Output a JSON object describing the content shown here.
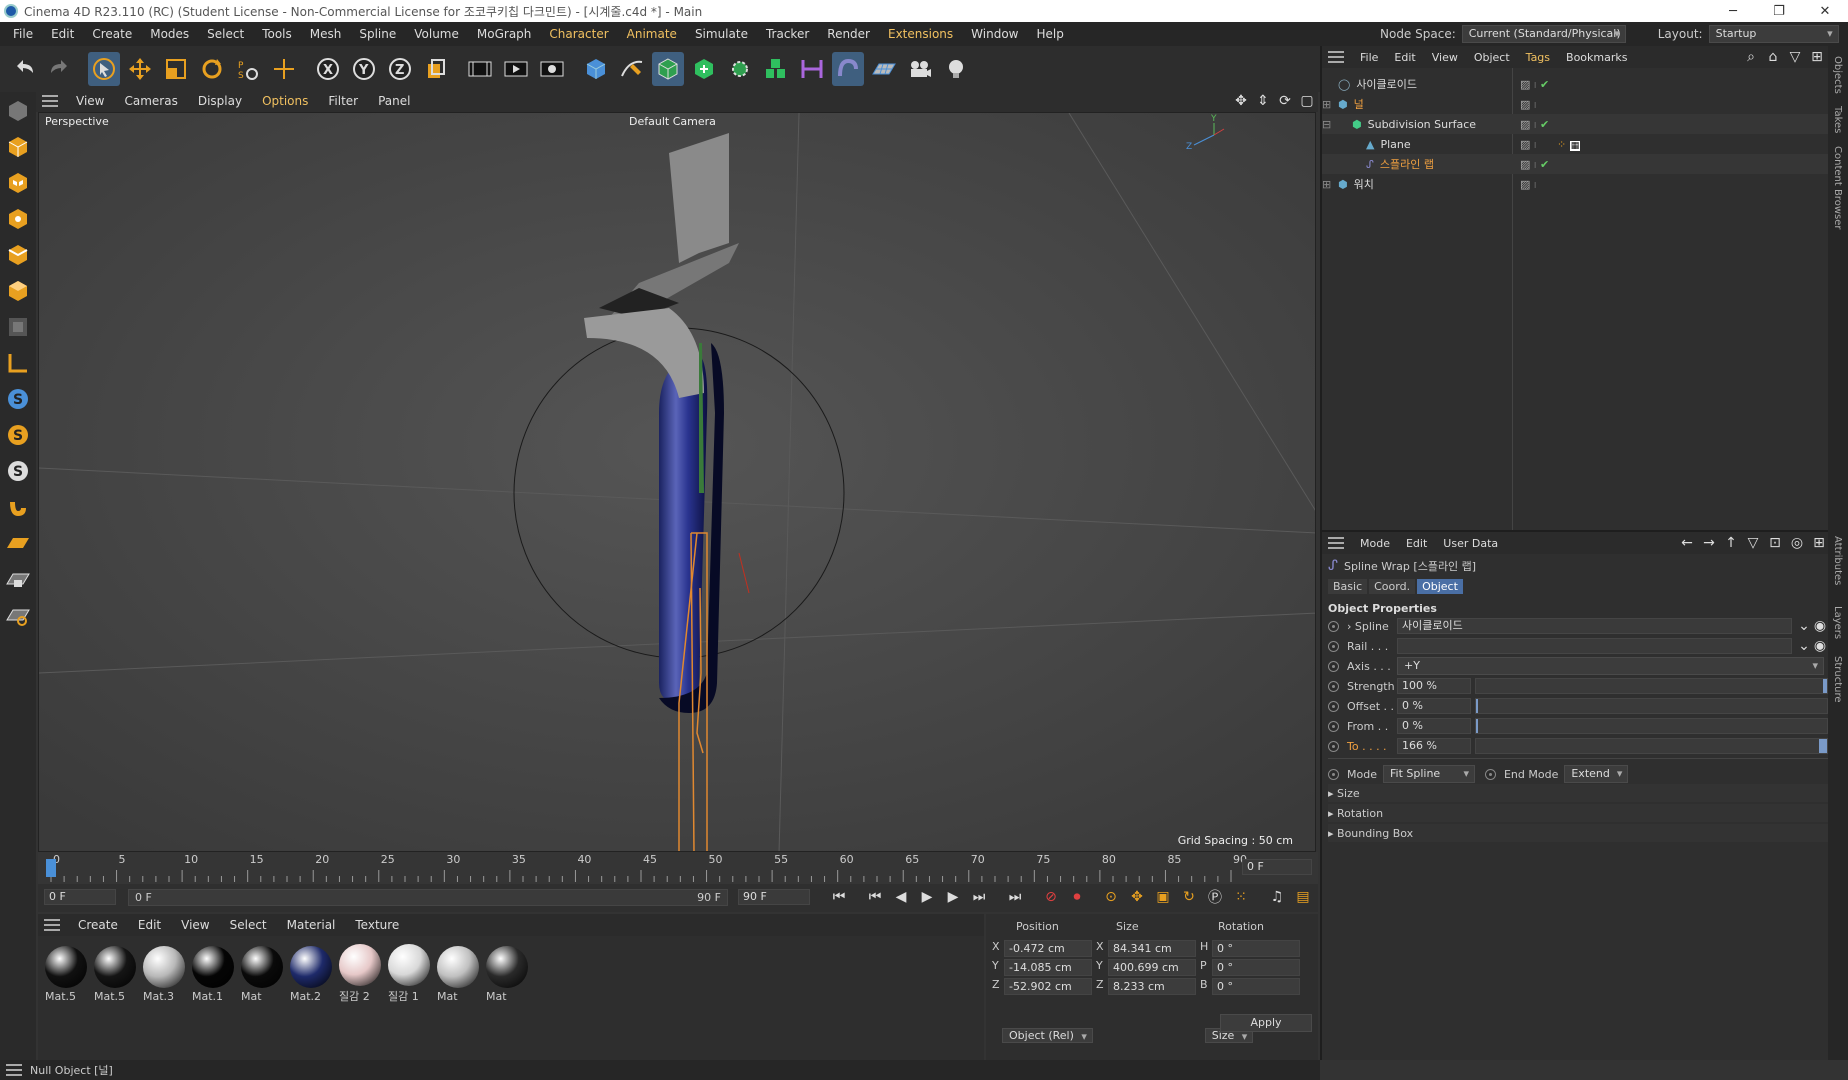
{
  "window": {
    "title": "Cinema 4D R23.110 (RC) (Student License - Non-Commercial License for 조코쿠키칩 다크민트) - [시계줄.c4d *] - Main",
    "min": "─",
    "max": "❐",
    "close": "✕"
  },
  "menu": [
    "File",
    "Edit",
    "Create",
    "Modes",
    "Select",
    "Tools",
    "Mesh",
    "Spline",
    "Volume",
    "MoGraph",
    "Character",
    "Animate",
    "Simulate",
    "Tracker",
    "Render",
    "Extensions",
    "Window",
    "Help"
  ],
  "nodespace": {
    "label": "Node Space:",
    "value": "Current (Standard/Physical)",
    "layout_label": "Layout:",
    "layout_value": "Startup"
  },
  "viewport": {
    "menu": [
      "View",
      "Cameras",
      "Display",
      "Options",
      "Filter",
      "Panel"
    ],
    "projection": "Perspective",
    "camera": "Default Camera",
    "grid_spacing": "Grid Spacing : 50 cm"
  },
  "timeline": {
    "ticks": [
      "0",
      "5",
      "10",
      "15",
      "20",
      "25",
      "30",
      "35",
      "40",
      "45",
      "50",
      "55",
      "60",
      "65",
      "70",
      "75",
      "80",
      "85",
      "90"
    ],
    "current_frame": "0 F",
    "start_frame": "0 F",
    "range_start": "0 F",
    "range_end": "90 F",
    "end_frame": "90 F"
  },
  "materials": {
    "menu": [
      "Create",
      "Edit",
      "View",
      "Select",
      "Material",
      "Texture"
    ],
    "items": [
      {
        "name": "Mat.5",
        "color": "#111"
      },
      {
        "name": "Mat.5",
        "color": "#151515"
      },
      {
        "name": "Mat.3",
        "color": "#b8b8b8"
      },
      {
        "name": "Mat.1",
        "color": "#050505"
      },
      {
        "name": "Mat",
        "color": "#0a0a0a"
      },
      {
        "name": "Mat.2",
        "color": "#1e2a6a"
      },
      {
        "name": "질감 2",
        "color": "#e6c8c8"
      },
      {
        "name": "질감 1",
        "color": "#d8d8d8"
      },
      {
        "name": "Mat",
        "color": "#c0c0c0"
      },
      {
        "name": "Mat",
        "color": "#2a2a2a"
      }
    ]
  },
  "coords": {
    "headers": [
      "Position",
      "Size",
      "Rotation"
    ],
    "rows": [
      {
        "axis": "X",
        "pos": "-0.472 cm",
        "size_axis": "X",
        "size": "84.341 cm",
        "rot_axis": "H",
        "rot": "0 °"
      },
      {
        "axis": "Y",
        "pos": "-14.085 cm",
        "size_axis": "Y",
        "size": "400.699 cm",
        "rot_axis": "P",
        "rot": "0 °"
      },
      {
        "axis": "Z",
        "pos": "-52.902 cm",
        "size_axis": "Z",
        "size": "8.233 cm",
        "rot_axis": "B",
        "rot": "0 °"
      }
    ],
    "mode": "Object (Rel)",
    "size_mode": "Size",
    "apply": "Apply"
  },
  "status": "Null Object [널]",
  "objects": {
    "menu": [
      "File",
      "Edit",
      "View",
      "Object",
      "Tags",
      "Bookmarks"
    ],
    "items": [
      {
        "name": "사이클로이드",
        "indent": 0
      },
      {
        "name": "널",
        "indent": 0
      },
      {
        "name": "Subdivision Surface",
        "indent": 1
      },
      {
        "name": "Plane",
        "indent": 2
      },
      {
        "name": "스플라인 랩",
        "indent": 2
      },
      {
        "name": "워치",
        "indent": 0
      }
    ]
  },
  "attributes": {
    "menu": [
      "Mode",
      "Edit",
      "User Data"
    ],
    "object_title": "Spline Wrap [스플라인 랩]",
    "tabs": [
      "Basic",
      "Coord.",
      "Object"
    ],
    "section": "Object Properties",
    "spline_label": "Spline",
    "spline_value": "사이클로이드",
    "rail_label": "Rail . . .",
    "axis_label": "Axis . . .",
    "axis_value": "+Y",
    "strength_label": "Strength",
    "strength_value": "100 %",
    "offset_label": "Offset . .",
    "offset_value": "0 %",
    "from_label": "From . .",
    "from_value": "0 %",
    "to_label": "To . . . .",
    "to_value": "166 %",
    "mode_label": "Mode",
    "mode_value": "Fit Spline",
    "endmode_label": "End Mode",
    "endmode_value": "Extend",
    "groups": [
      "Size",
      "Rotation",
      "Bounding Box"
    ]
  },
  "sidetabs": [
    "Objects",
    "Takes",
    "Content Browser",
    "Attributes",
    "Layers",
    "Structure"
  ]
}
